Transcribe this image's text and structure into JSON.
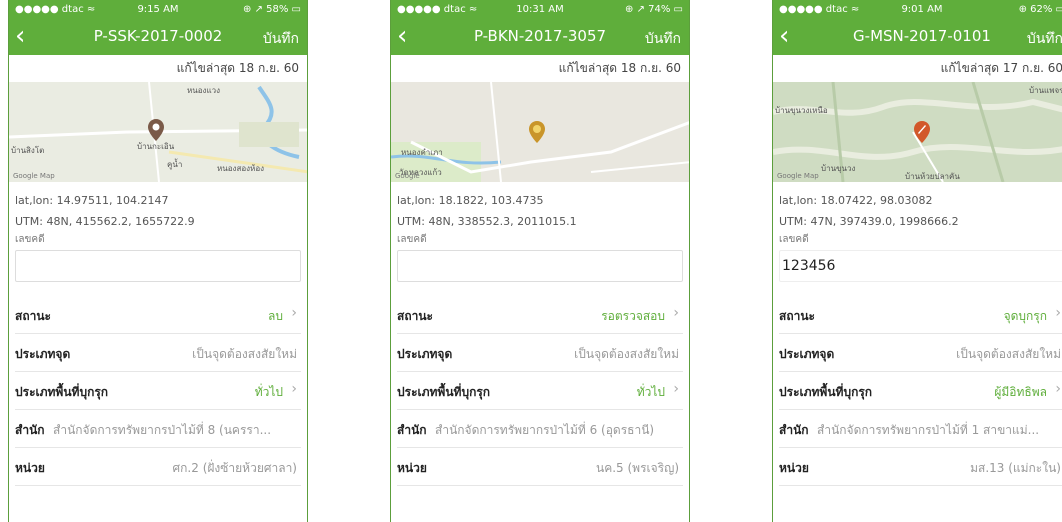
{
  "colors": {
    "brand_green": "#5fae3b",
    "value_gray": "#999999",
    "label_dark": "#222222"
  },
  "screens": [
    {
      "status": {
        "carrier": "●●●●● dtac ≈",
        "time": "9:15 AM",
        "battery": "⊕ ↗ 58% ▭"
      },
      "nav": {
        "title": "P-SSK-2017-0002",
        "save": "บันทึก"
      },
      "last_edit": "แก้ไขล่าสุด 18 ก.ย. 60",
      "map": {
        "labels": [
          "หนองแวง",
          "บ้านสิงโต",
          "บ้านกะเอิน",
          "คูน้ำ",
          "หนองสองห้อง"
        ],
        "google": "Google Map",
        "pin_color": "#7a5a48"
      },
      "latlon": "lat,lon: 14.97511, 104.2147",
      "utm": "UTM: 48N, 415562.2, 1655722.9",
      "lekdi_label": "เลขคดี",
      "lekdi_value": "",
      "status_label": "สถานะ",
      "status_value": "ลบ",
      "type_label": "ประเภทจุด",
      "type_value": "เป็นจุดต้องสงสัยใหม่",
      "area_label": "ประเภทพื้นที่บุกรุก",
      "area_value": "ทั่วไป",
      "office_label": "สำนัก",
      "office_value": "สำนักจัดการทรัพยากรป่าไม้ที่ 8 (นครรา...",
      "unit_label": "หน่วย",
      "unit_value": "ศก.2 (ฝั่งซ้ายห้วยศาลา)"
    },
    {
      "status": {
        "carrier": "●●●●● dtac ≈",
        "time": "10:31 AM",
        "battery": "⊕ ↗ 74% ▭"
      },
      "nav": {
        "title": "P-BKN-2017-3057",
        "save": "บันทึก"
      },
      "last_edit": "แก้ไขล่าสุด 18 ก.ย. 60",
      "map": {
        "labels": [
          "หนองคำเภา",
          "วัดหลวงแก้ว"
        ],
        "google": "Google",
        "pin_color": "#c9952a"
      },
      "latlon": "lat,lon: 18.1822, 103.4735",
      "utm": "UTM: 48N, 338552.3, 2011015.1",
      "lekdi_label": "เลขคดี",
      "lekdi_value": "",
      "status_label": "สถานะ",
      "status_value": "รอตรวจสอบ",
      "type_label": "ประเภทจุด",
      "type_value": "เป็นจุดต้องสงสัยใหม่",
      "area_label": "ประเภทพื้นที่บุกรุก",
      "area_value": "ทั่วไป",
      "office_label": "สำนัก",
      "office_value": "สำนักจัดการทรัพยากรป่าไม้ที่ 6 (อุดรธานี)",
      "unit_label": "หน่วย",
      "unit_value": "นค.5 (พรเจริญ)"
    },
    {
      "status": {
        "carrier": "●●●●● dtac ≈",
        "time": "9:01 AM",
        "battery": "⊕ 62% ▭"
      },
      "nav": {
        "title": "G-MSN-2017-0101",
        "save": "บันทึก"
      },
      "last_edit": "แก้ไขล่าสุด 17 ก.ย. 60",
      "map": {
        "labels": [
          "บ้านขุนวงเหนือ",
          "บ้านขุนวง",
          "บ้านห้วยปลาคัน",
          "บ้านแพจร"
        ],
        "google": "Google Map",
        "pin_color": "#d2582a"
      },
      "latlon": "lat,lon: 18.07422, 98.03082",
      "utm": "UTM: 47N, 397439.0, 1998666.2",
      "lekdi_label": "เลขคดี",
      "lekdi_value": "123456",
      "status_label": "สถานะ",
      "status_value": "จุดบุกรุก",
      "type_label": "ประเภทจุด",
      "type_value": "เป็นจุดต้องสงสัยใหม่",
      "area_label": "ประเภทพื้นที่บุกรุก",
      "area_value": "ผู้มีอิทธิพล",
      "office_label": "สำนัก",
      "office_value": "สำนักจัดการทรัพยากรป่าไม้ที่ 1 สาขาแม่...",
      "unit_label": "หน่วย",
      "unit_value": "มส.13 (แม่กะใน)"
    }
  ]
}
